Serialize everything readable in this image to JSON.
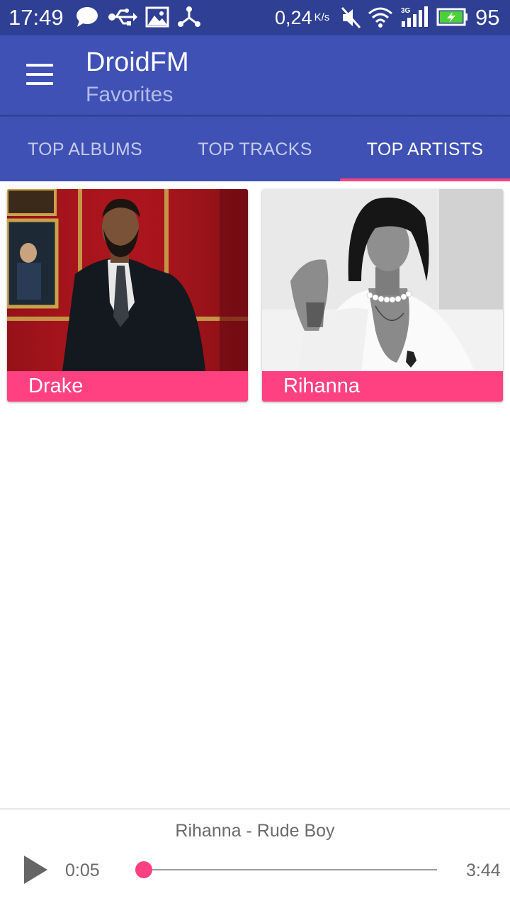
{
  "status_bar": {
    "time": "17:49",
    "net_speed": "0,24",
    "net_speed_unit": "K/s",
    "battery_level": "95",
    "icons": [
      "chat-bubble-icon",
      "usb-icon",
      "image-icon",
      "share-hub-icon",
      "muted-speaker-icon",
      "wifi-icon",
      "signal-3g-icon",
      "battery-charging-icon"
    ]
  },
  "app_bar": {
    "title": "DroidFM",
    "subtitle": "Favorites"
  },
  "tabs": [
    {
      "label": "TOP ALBUMS",
      "active": false
    },
    {
      "label": "TOP TRACKS",
      "active": false
    },
    {
      "label": "TOP ARTISTS",
      "active": true
    }
  ],
  "artists": [
    {
      "name": "Drake"
    },
    {
      "name": "Rihanna"
    }
  ],
  "player": {
    "now_playing": "Rihanna - Rude Boy",
    "current_time": "0:05",
    "total_time": "3:44",
    "progress": 0.022
  },
  "colors": {
    "primary": "#3f51b5",
    "primary_dark": "#2f3f94",
    "accent": "#ff4081"
  }
}
